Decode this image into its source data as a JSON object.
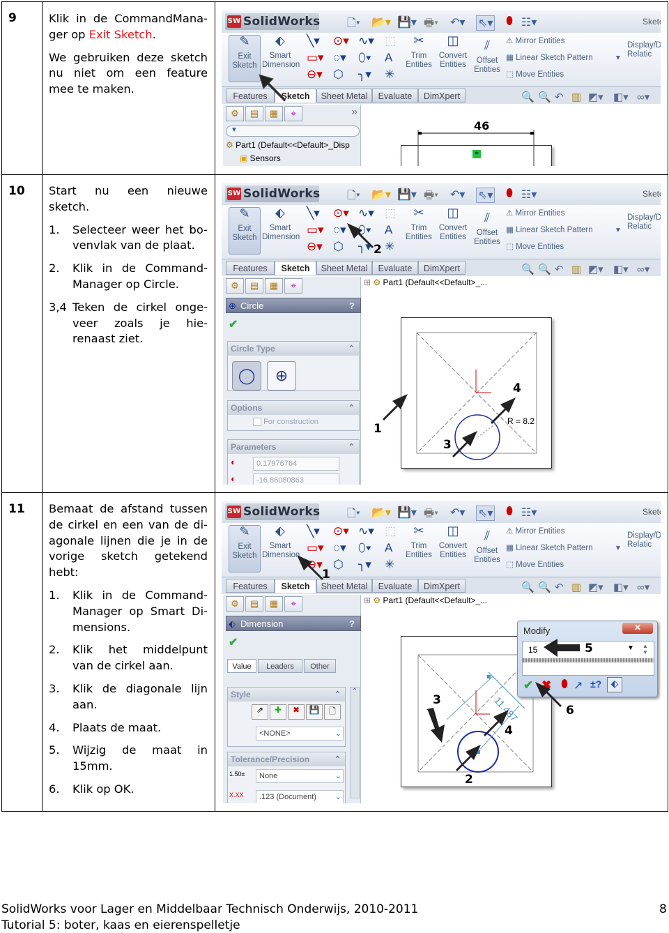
{
  "ui": {
    "logo": "SolidWorks",
    "logo_badge": "SW",
    "sketch_cut": "Sketc",
    "exit_sketch": "Exit Sketch",
    "smart_dimension": "Smart Dimension",
    "trim": "Trim Entities",
    "convert": "Convert Entities",
    "offset": "Offset Entities",
    "mirror": "Mirror Entities",
    "linear": "Linear Sketch Pattern",
    "move": "Move Entities",
    "display": "Display/D Relatic",
    "tabs": [
      "Features",
      "Sketch",
      "Sheet Metal",
      "Evaluate",
      "DimXpert"
    ],
    "tree_part": "Part1  (Default<<Default>_...",
    "icons": [
      "new-document-icon",
      "open-folder-icon",
      "save-icon",
      "print-icon",
      "undo-icon",
      "select-pointer-icon",
      "rebuild-traffic-light-icon",
      "options-list-icon"
    ]
  },
  "rows": [
    {
      "num": "9",
      "text_pre": "Klik in de CommandMana-ger op ",
      "text_red": "Exit Sketch",
      "text_post": ".",
      "p2": "We gebruiken deze sketch nu niet om een feature mee te maken.",
      "tree_part": "Part1  (Default<<Default>_Disp",
      "sensors": "Sensors",
      "dimension": "46",
      "relation": "="
    },
    {
      "num": "10",
      "p1": "Start nu een nieuwe sketch.",
      "items": [
        {
          "n": "1.",
          "t": "Selecteer weer het bo-venvlak van de plaat."
        },
        {
          "n": "2.",
          "t": "Klik in de Command-Manager op Circle."
        },
        {
          "n": "3,4",
          "t": "Teken de cirkel onge-veer zoals je hie-renaast ziet."
        }
      ],
      "pm_title": "Circle",
      "circle_type": "Circle Type",
      "options": "Options",
      "for_construction": "For construction",
      "parameters": "Parameters",
      "param_x": "0.17976764",
      "param_y": "-16.86080863",
      "radius": "R = 8.2",
      "labels": [
        "1",
        "2",
        "3",
        "4"
      ]
    },
    {
      "num": "11",
      "p1": "Bemaat de afstand tussen de cirkel en een van de di-agonale lijnen die je in de vorige sketch getekend hebt:",
      "items": [
        {
          "n": "1.",
          "t": "Klik in de Command-Manager op Smart Di-mensions."
        },
        {
          "n": "2.",
          "t": "Klik het middelpunt van de cirkel aan."
        },
        {
          "n": "3.",
          "t": "Klik de diagonale lijn aan."
        },
        {
          "n": "4.",
          "t": "Plaats de maat."
        },
        {
          "n": "5.",
          "t": "Wijzig de maat in 15mm."
        },
        {
          "n": "6.",
          "t": "Klik op OK."
        }
      ],
      "pm_title": "Dimension",
      "subtabs": [
        "Value",
        "Leaders",
        "Other"
      ],
      "style": "Style",
      "style_value": "<NONE>",
      "tolerance": "Tolerance/Precision",
      "tol_value": "None",
      "prec_value": ".123 (Document)",
      "modify_title": "Modify",
      "modify_value": "15",
      "dim_value": "11.487",
      "labels": [
        "1",
        "2",
        "3",
        "4",
        "5",
        "6"
      ]
    }
  ],
  "footer": {
    "line1": "SolidWorks voor Lager en Middelbaar Technisch Onderwijs, 2010-2011",
    "line2": "Tutorial 5: boter, kaas en eierenspelletje",
    "page": "8"
  }
}
